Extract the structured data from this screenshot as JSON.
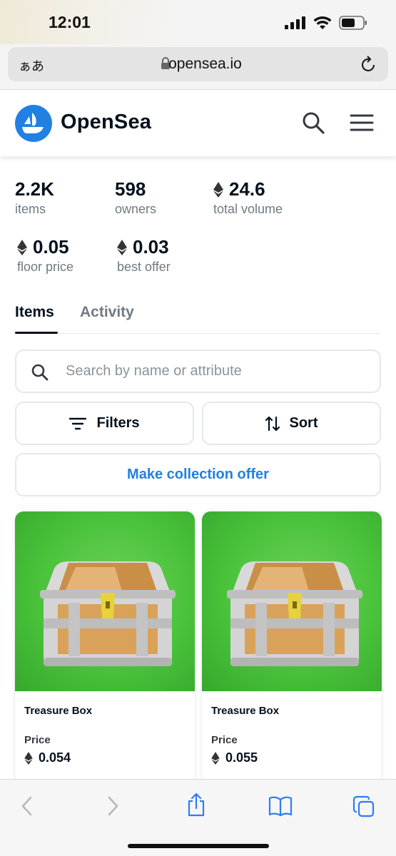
{
  "status_bar": {
    "time": "12:01"
  },
  "browser": {
    "aa_label": "ぁあ",
    "domain": "opensea.io"
  },
  "site": {
    "brand": "OpenSea"
  },
  "stats": [
    {
      "value": "2.2K",
      "label": "items",
      "eth": false
    },
    {
      "value": "598",
      "label": "owners",
      "eth": false
    },
    {
      "value": "24.6",
      "label": "total volume",
      "eth": true
    },
    {
      "value": "0.05",
      "label": "floor price",
      "eth": true
    },
    {
      "value": "0.03",
      "label": "best offer",
      "eth": true
    }
  ],
  "tabs": [
    {
      "label": "Items",
      "active": true
    },
    {
      "label": "Activity",
      "active": false
    }
  ],
  "search": {
    "placeholder": "Search by name or attribute"
  },
  "buttons": {
    "filters": "Filters",
    "sort": "Sort",
    "offer": "Make collection offer"
  },
  "cards": [
    {
      "name": "Treasure Box",
      "price_label": "Price",
      "price": "0.054"
    },
    {
      "name": "Treasure Box",
      "price_label": "Price",
      "price": "0.055"
    }
  ],
  "colors": {
    "accent": "#2081e2",
    "text": "#04111d",
    "muted": "#707a83",
    "card_bg": "#49c23a"
  }
}
